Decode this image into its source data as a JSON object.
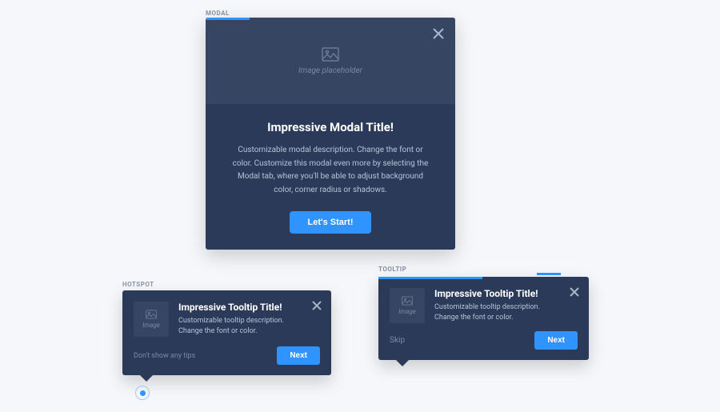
{
  "sections": {
    "modal_label": "MODAL",
    "hotspot_label": "HOTSPOT",
    "tooltip_label": "TOOLTIP"
  },
  "modal": {
    "image_placeholder": "Image placeholder",
    "title": "Impressive Modal Title!",
    "description": "Customizable modal description. Change the font or color. Customize this modal even more by selecting the Modal tab, where you'll be able to adjust background color, corner radius or shadows.",
    "cta": "Let's Start!"
  },
  "hotspot": {
    "image_placeholder": "Image",
    "title": "Impressive Tooltip Title!",
    "description": "Customizable tooltip description. Change the font or color.",
    "dont_show": "Don't show any tips",
    "next": "Next"
  },
  "tooltip": {
    "image_placeholder": "Image",
    "title": "Impressive Tooltip Title!",
    "description": "Customizable tooltip description. Change the font or color.",
    "skip": "Skip",
    "next": "Next"
  }
}
